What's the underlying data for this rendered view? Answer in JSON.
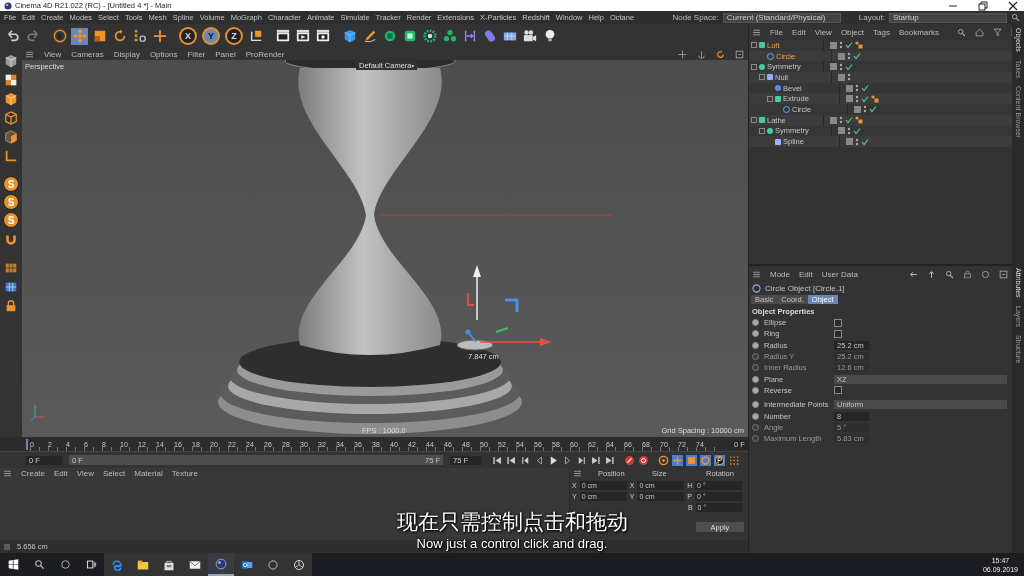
{
  "window": {
    "title": "Cinema 4D R21.022 (RC) - [Untitled 4 *] - Main"
  },
  "menu": [
    "File",
    "Edit",
    "Create",
    "Modes",
    "Select",
    "Tools",
    "Mesh",
    "Spline",
    "Volume",
    "MoGraph",
    "Character",
    "Animate",
    "Simulate",
    "Tracker",
    "Render",
    "Extensions",
    "X-Particles",
    "Redshift",
    "Window",
    "Help",
    "Octane"
  ],
  "node_space": {
    "label": "Node Space:",
    "value": "Current (Standard/Physical)"
  },
  "layout": {
    "label": "Layout:",
    "value": "Startup"
  },
  "tools": [
    {
      "kind": "select",
      "selected": false
    },
    {
      "kind": "move",
      "selected": true
    },
    {
      "kind": "scale",
      "selected": false
    },
    {
      "kind": "rotate",
      "selected": false
    }
  ],
  "axis_buttons": [
    {
      "label": "X",
      "selected": false
    },
    {
      "label": "Y",
      "selected": true
    },
    {
      "label": "Z",
      "selected": false
    }
  ],
  "snap_buttons": [
    "S",
    "S",
    "S"
  ],
  "viewport": {
    "menu": [
      "View",
      "Cameras",
      "Display",
      "Options",
      "Filter",
      "Panel",
      "ProRender"
    ],
    "view_name": "Perspective",
    "camera": "Default Camera•",
    "measure": "7.847 cm",
    "fps": "FPS : 1000.0",
    "grid_spacing": "Grid Spacing : 10000 cm"
  },
  "timeline": {
    "ticks": [
      "0",
      "2",
      "4",
      "6",
      "8",
      "10",
      "12",
      "14",
      "16",
      "18",
      "20",
      "22",
      "24",
      "26",
      "28",
      "30",
      "32",
      "34",
      "36",
      "38",
      "40",
      "42",
      "44",
      "46",
      "48",
      "50",
      "52",
      "54",
      "56",
      "58",
      "60",
      "62",
      "64",
      "66",
      "68",
      "70",
      "72",
      "74"
    ],
    "end_field": "0 F",
    "current": "0 F",
    "range_start": "0 F",
    "range_end": "75 F",
    "level": 1,
    "max": "75 F"
  },
  "materials": {
    "menu": [
      "Create",
      "Edit",
      "View",
      "Select",
      "Material",
      "Texture"
    ]
  },
  "coordinates": {
    "headers": [
      "Position",
      "Size",
      "Rotation"
    ],
    "rows": [
      {
        "pos_axis": "X",
        "position": "0 cm",
        "size_axis": "X",
        "size": "0 cm",
        "rot_axis": "H",
        "rotation": "0 °"
      },
      {
        "pos_axis": "Y",
        "position": "0 cm",
        "size_axis": "Y",
        "size": "0 cm",
        "rot_axis": "P",
        "rotation": "0 °"
      },
      {
        "rot_axis": "B",
        "rotation": "0 °"
      }
    ],
    "apply": "Apply"
  },
  "status_bar": {
    "text": "5.656 cm"
  },
  "objects": {
    "menu": [
      "File",
      "Edit",
      "View",
      "Object",
      "Tags",
      "Bookmarks"
    ],
    "tree": [
      {
        "name": "Loft",
        "kind": "loft",
        "selected": true,
        "enabled": true,
        "tag": true,
        "children": [
          {
            "name": "Circle",
            "kind": "circle",
            "selected": true,
            "enabled": true,
            "tag": false
          }
        ]
      },
      {
        "name": "Symmetry",
        "kind": "symmetry",
        "selected": false,
        "enabled": true,
        "tag": false,
        "children": [
          {
            "name": "Null",
            "kind": "null",
            "selected": false,
            "enabled": false,
            "tag": false,
            "children": [
              {
                "name": "Bevel",
                "kind": "bevel",
                "selected": false,
                "enabled": true,
                "tag": false
              },
              {
                "name": "Extrude",
                "kind": "extrude",
                "selected": false,
                "enabled": true,
                "tag": true,
                "children": [
                  {
                    "name": "Circle",
                    "kind": "circle",
                    "selected": false,
                    "enabled": true,
                    "tag": false
                  }
                ]
              }
            ]
          }
        ]
      },
      {
        "name": "Lathe",
        "kind": "lathe",
        "selected": false,
        "enabled": true,
        "tag": true,
        "children": [
          {
            "name": "Symmetry",
            "kind": "symmetry",
            "selected": false,
            "enabled": true,
            "tag": false,
            "children": [
              {
                "name": "Spline",
                "kind": "spline",
                "selected": false,
                "enabled": true,
                "tag": false
              }
            ]
          }
        ]
      }
    ]
  },
  "attributes": {
    "menu": [
      "Mode",
      "Edit",
      "User Data"
    ],
    "object_title": "Circle Object [Circle.1]",
    "tabs": [
      {
        "label": "Basic",
        "selected": false
      },
      {
        "label": "Coord.",
        "selected": false
      },
      {
        "label": "Object",
        "selected": true
      }
    ],
    "section": "Object Properties",
    "params": [
      {
        "kind": "checkbox",
        "label": "Ellipse",
        "checked": false,
        "disabled": false
      },
      {
        "kind": "checkbox",
        "label": "Ring",
        "checked": false,
        "disabled": false
      },
      {
        "kind": "number",
        "label": "Radius",
        "value": "25.2 cm",
        "disabled": false
      },
      {
        "kind": "number",
        "label": "Radius Y",
        "value": "25.2 cm",
        "disabled": true
      },
      {
        "kind": "number",
        "label": "Inner Radius",
        "value": "12.6 cm",
        "disabled": true
      },
      {
        "kind": "dropdown",
        "label": "Plane",
        "value": "XZ",
        "disabled": false
      },
      {
        "kind": "checkbox",
        "label": "Reverse",
        "checked": false,
        "disabled": false
      },
      {
        "kind": "dropdown",
        "label": "Intermediate Points",
        "value": "Uniform",
        "disabled": false
      },
      {
        "kind": "number",
        "label": "Number",
        "value": "8",
        "disabled": false
      },
      {
        "kind": "number",
        "label": "Angle",
        "value": "5 °",
        "disabled": true
      },
      {
        "kind": "number",
        "label": "Maximum Length",
        "value": "5.83 cm",
        "disabled": true
      }
    ]
  },
  "side_tabs_top": [
    {
      "label": "Objects",
      "selected": true
    },
    {
      "label": "Takes",
      "selected": false
    },
    {
      "label": "Content Browser",
      "selected": false
    }
  ],
  "side_tabs_bottom": [
    {
      "label": "Attributes",
      "selected": true
    },
    {
      "label": "Layers",
      "selected": false
    },
    {
      "label": "Structure",
      "selected": false
    }
  ],
  "subtitles": {
    "chinese": "现在只需控制点击和拖动",
    "english": "Now just a control click and drag."
  },
  "taskbar": {
    "apps": [
      {
        "kind": "browser",
        "selected": false
      },
      {
        "kind": "folder",
        "selected": false
      },
      {
        "kind": "bag",
        "selected": false
      },
      {
        "kind": "mail",
        "selected": false
      },
      {
        "kind": "sphere",
        "selected": true
      },
      {
        "kind": "letter",
        "selected": false
      },
      {
        "kind": "ring",
        "selected": false
      },
      {
        "kind": "wheel",
        "selected": false
      }
    ],
    "time": "15:47",
    "date": "06.09.2019"
  }
}
